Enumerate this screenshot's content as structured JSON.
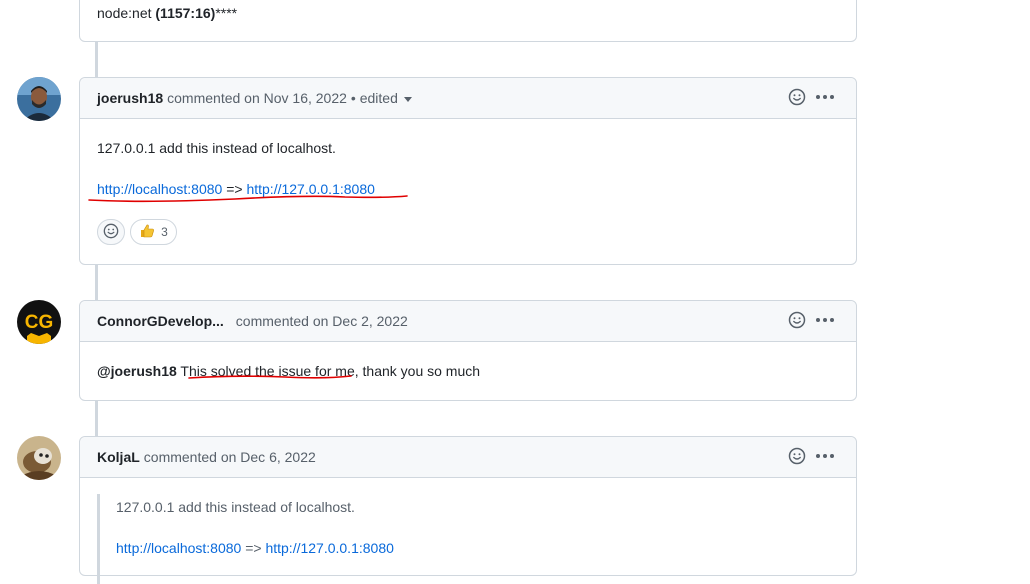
{
  "top_comment": {
    "text_prefix": "node:net ",
    "text_bold": "(1157:16)",
    "text_suffix": "****"
  },
  "comments": [
    {
      "author": "joerush18",
      "meta": "commented on Nov 16, 2022",
      "edited": " • edited",
      "line1": "127.0.0.1 add this instead of localhost.",
      "link1": "http://localhost:8080",
      "arrow": " => ",
      "link2": "http://127.0.0.1:8080",
      "reaction_count": "3"
    },
    {
      "author": "ConnorGDevelop...",
      "meta": "commented on Dec 2, 2022",
      "mention": "@joerush18",
      "text_a": " This solved the issue for me",
      "text_b": ", thank you so much"
    },
    {
      "author": "KoljaL",
      "meta": "commented on Dec 6, 2022",
      "quote_line1": "127.0.0.1 add this instead of localhost.",
      "link1": "http://localhost:8080",
      "arrow": " => ",
      "link2": "http://127.0.0.1:8080"
    }
  ],
  "icons": {
    "smiley": "smiley-icon",
    "kebab": "kebab-horizontal-icon",
    "thumbs_up": "thumbs-up-emoji"
  },
  "colors": {
    "link": "#0969da",
    "border": "#d0d7de",
    "header_bg": "#f6f8fa",
    "annotation_red": "#e00000"
  }
}
